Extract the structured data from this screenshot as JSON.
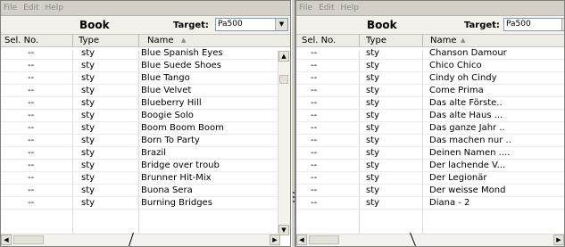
{
  "menu": [
    "File",
    "Edit",
    "Help"
  ],
  "left": {
    "title": "Book",
    "target_label": "Target:",
    "target_value": "Pa500",
    "columns": {
      "sel": "Sel. No.",
      "type": "Type",
      "name": "Name"
    },
    "rows": [
      {
        "sel": "--",
        "type": "sty",
        "name": "Blue Spanish Eyes"
      },
      {
        "sel": "--",
        "type": "sty",
        "name": "Blue Suede Shoes"
      },
      {
        "sel": "--",
        "type": "sty",
        "name": "Blue Tango"
      },
      {
        "sel": "--",
        "type": "sty",
        "name": "Blue Velvet"
      },
      {
        "sel": "--",
        "type": "sty",
        "name": "Blueberry Hill"
      },
      {
        "sel": "--",
        "type": "sty",
        "name": "Boogie Solo"
      },
      {
        "sel": "--",
        "type": "sty",
        "name": "Boom Boom Boom"
      },
      {
        "sel": "--",
        "type": "sty",
        "name": "Born To Party"
      },
      {
        "sel": "--",
        "type": "sty",
        "name": "Brazil"
      },
      {
        "sel": "--",
        "type": "sty",
        "name": "Bridge over troub"
      },
      {
        "sel": "--",
        "type": "sty",
        "name": "Brunner Hit-Mix"
      },
      {
        "sel": "--",
        "type": "sty",
        "name": "Buona Sera"
      },
      {
        "sel": "--",
        "type": "sty",
        "name": "Burning Bridges"
      }
    ]
  },
  "right": {
    "title": "Book",
    "target_label": "Target:",
    "target_value": "Pa500",
    "columns": {
      "sel": "Sel. No.",
      "type": "Type",
      "name": "Name"
    },
    "rows": [
      {
        "sel": "--",
        "type": "sty",
        "name": "Chanson Damour"
      },
      {
        "sel": "--",
        "type": "sty",
        "name": "Chico Chico"
      },
      {
        "sel": "--",
        "type": "sty",
        "name": "Cindy oh Cindy"
      },
      {
        "sel": "--",
        "type": "sty",
        "name": "Come Prima"
      },
      {
        "sel": "--",
        "type": "sty",
        "name": "Das alte Förste.."
      },
      {
        "sel": "--",
        "type": "sty",
        "name": "Das alte Haus ..."
      },
      {
        "sel": "--",
        "type": "sty",
        "name": "Das ganze Jahr .."
      },
      {
        "sel": "--",
        "type": "sty",
        "name": "Das machen nur .."
      },
      {
        "sel": "--",
        "type": "sty",
        "name": "Deinen Namen ...."
      },
      {
        "sel": "--",
        "type": "sty",
        "name": "Der lachende V..."
      },
      {
        "sel": "--",
        "type": "sty",
        "name": "Der Legionär"
      },
      {
        "sel": "--",
        "type": "sty",
        "name": "Der weisse Mond"
      },
      {
        "sel": "--",
        "type": "sty",
        "name": "Diana - 2"
      }
    ]
  },
  "icons": {
    "sort": "sort-ascending-icon",
    "dropdown": "chevron-down-icon",
    "scroll_up": "scroll-up-arrow-icon",
    "scroll_down": "scroll-down-arrow-icon",
    "scroll_left": "scroll-left-arrow-icon",
    "scroll_right": "scroll-right-arrow-icon"
  }
}
